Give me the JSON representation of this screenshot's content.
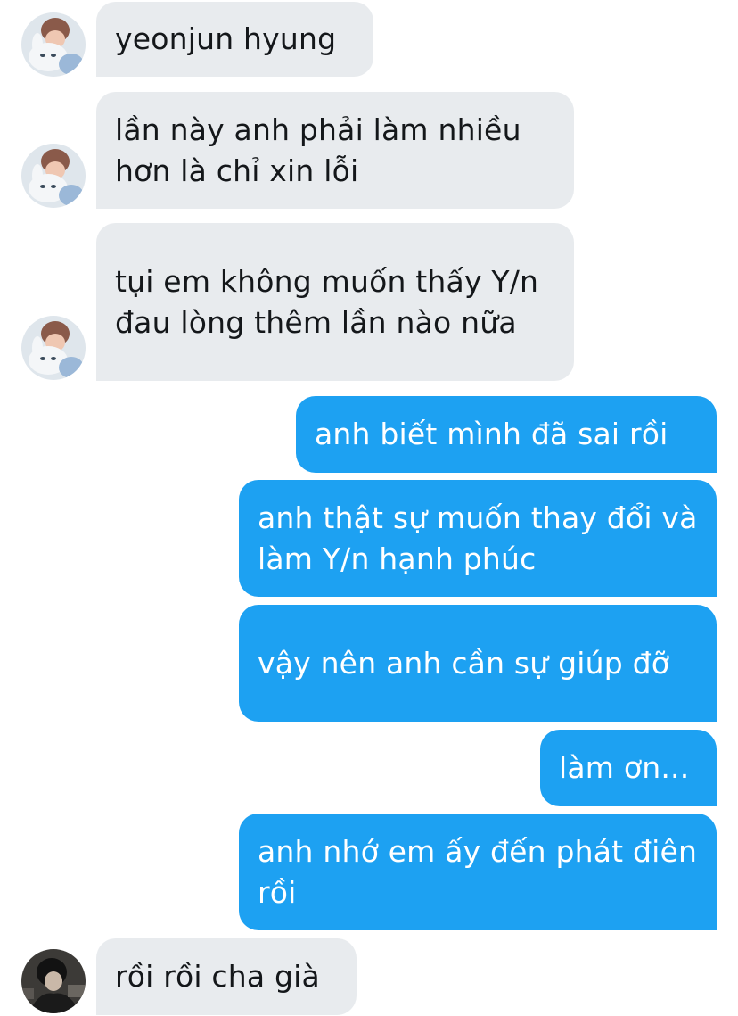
{
  "conversation": {
    "messages": [
      {
        "sender": "them",
        "text": "yeonjun hyung",
        "avatar": "bunny-plush-user-avatar"
      },
      {
        "sender": "them",
        "text": "lần này anh phải làm nhiều hơn là chỉ xin lỗi",
        "avatar": "bunny-plush-user-avatar"
      },
      {
        "sender": "them",
        "text": "tụi em không muốn thấy Y/n đau lòng thêm lần nào nữa",
        "avatar": "bunny-plush-user-avatar"
      },
      {
        "sender": "me",
        "text": "anh biết mình đã sai rồi"
      },
      {
        "sender": "me",
        "text": "anh thật sự muốn thay đổi và làm Y/n hạnh phúc"
      },
      {
        "sender": "me",
        "text": "vậy nên anh cần sự giúp đỡ"
      },
      {
        "sender": "me",
        "text": "làm ơn..."
      },
      {
        "sender": "me",
        "text": "anh nhớ em ấy đến phát điên rồi"
      },
      {
        "sender": "them",
        "text": "rồi rồi cha già",
        "avatar": "dark-photo-user-avatar"
      }
    ]
  },
  "colors": {
    "incoming_bubble": "#e8ebee",
    "incoming_text": "#14171a",
    "outgoing_bubble": "#1da1f2",
    "outgoing_text": "#ffffff"
  }
}
